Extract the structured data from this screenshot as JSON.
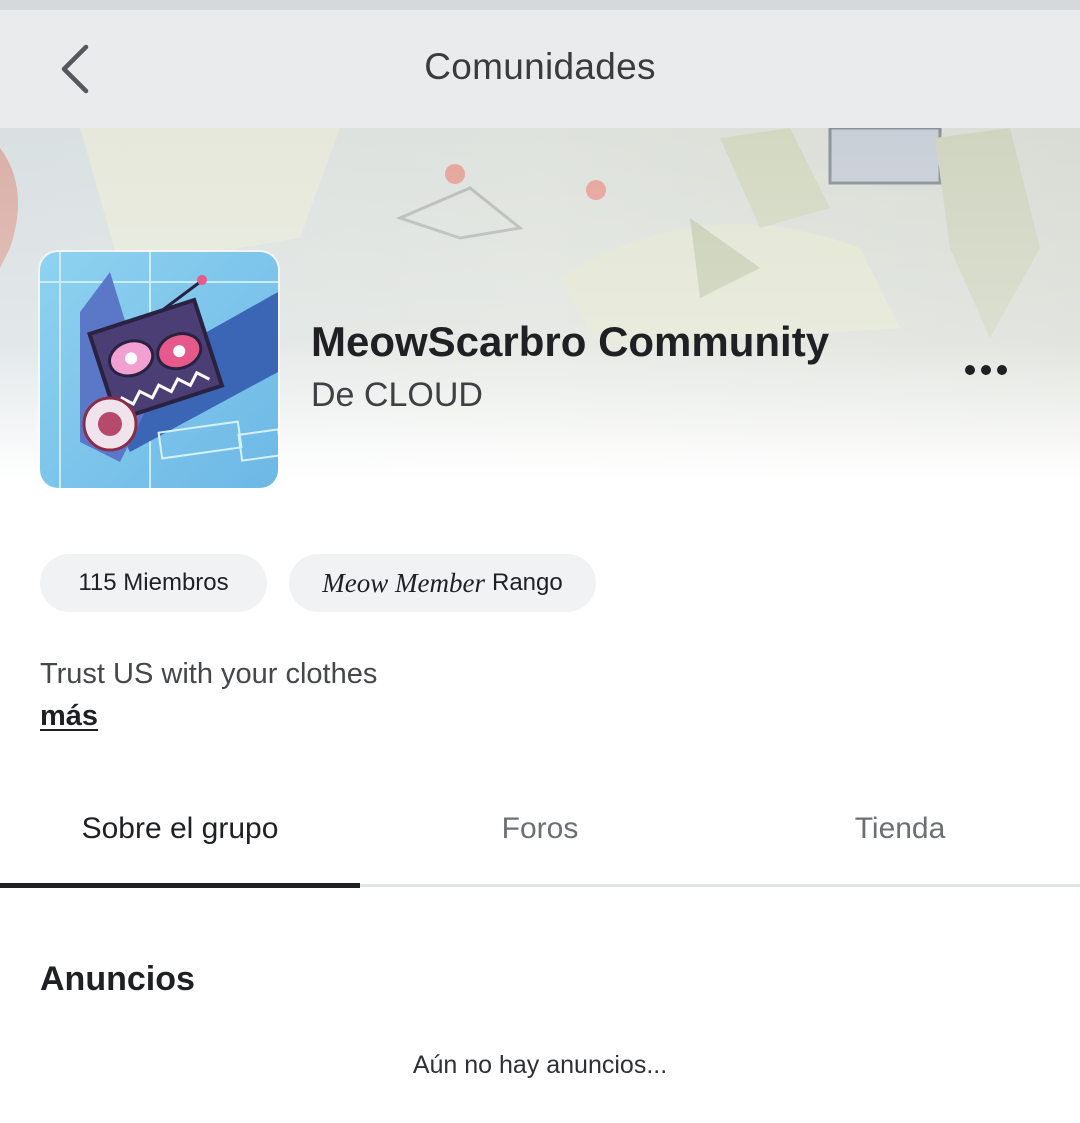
{
  "header": {
    "title": "Comunidades",
    "back_icon": "chevron-left-icon"
  },
  "community": {
    "name": "MeowScarbro Community",
    "owner": "De CLOUD",
    "more_icon": "ellipsis-icon"
  },
  "stats": {
    "members": "115 Miembros",
    "rank_name": "Meow Member",
    "rank_label": "Rango"
  },
  "description": {
    "text": "Trust US with your clothes",
    "more_label": "más"
  },
  "tabs": [
    {
      "label": "Sobre el grupo",
      "active": true
    },
    {
      "label": "Foros",
      "active": false
    },
    {
      "label": "Tienda",
      "active": false
    }
  ],
  "announcements": {
    "title": "Anuncios",
    "empty_text": "Aún no hay anuncios..."
  },
  "colors": {
    "header_bg": "#e9ebec",
    "text_primary": "#1f2023",
    "text_secondary": "#6c6f73",
    "pill_bg": "#f1f2f3"
  }
}
